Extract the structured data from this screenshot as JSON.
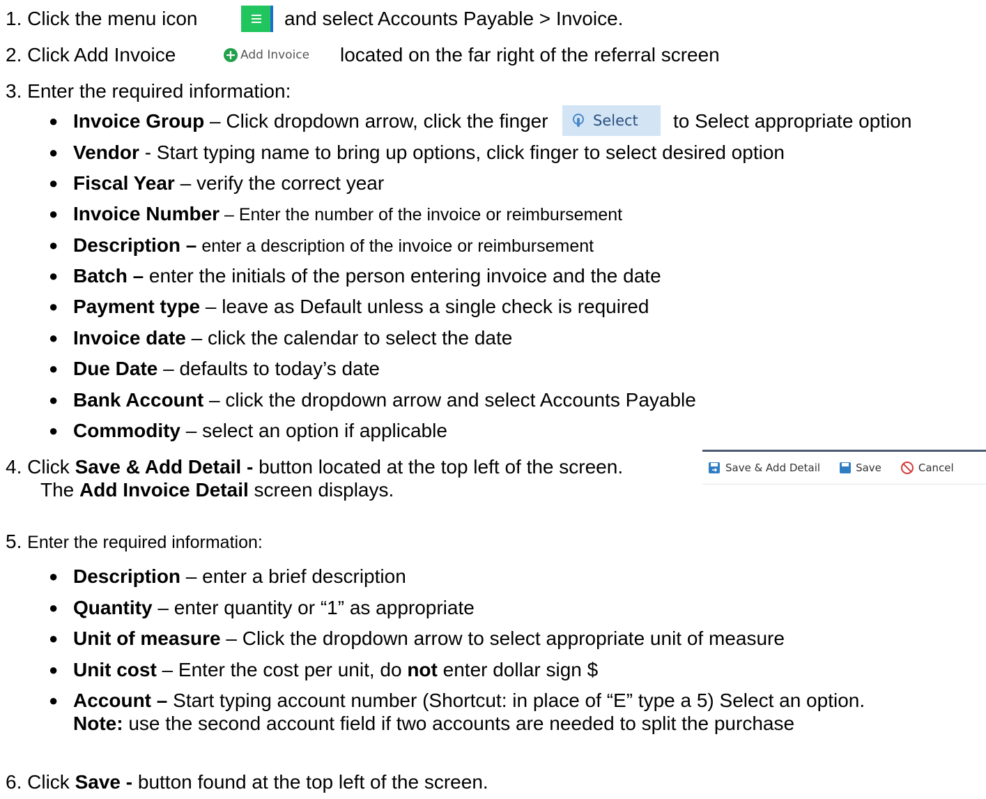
{
  "steps": {
    "s1": {
      "num": "1.",
      "pre": "Click the menu icon",
      "post": "and select Accounts Payable > Invoice."
    },
    "s2": {
      "num": "2.",
      "pre": "Click Add Invoice",
      "btn": "Add Invoice",
      "post": "located on the far right of the referral screen"
    },
    "s3": {
      "num": "3.",
      "text": "Enter the required information:"
    },
    "s4": {
      "num": "4.",
      "pre": "Click ",
      "bold": "Save & Add Detail -",
      "post": " button located at the top left of the screen.",
      "l2pre": "The ",
      "l2bold": "Add Invoice Detail",
      "l2post": " screen displays."
    },
    "s5": {
      "num": "5.",
      "text": "Enter the required information:"
    },
    "s6": {
      "num": "6.",
      "pre": "Click ",
      "bold": "Save -",
      "post": " button found at the top left of the screen."
    }
  },
  "bullets3": [
    {
      "label": "Invoice Group",
      "pre": " – Click dropdown arrow, click the finger",
      "btn": "Select",
      "post": "to Select appropriate option"
    },
    {
      "label": "Vendor",
      "text": " - Start typing name to bring up options, click finger to select desired option"
    },
    {
      "label": "Fiscal Year",
      "text": " – verify the correct year"
    },
    {
      "label": "Invoice Number",
      "text": " – Enter the number of the invoice or reimbursement"
    },
    {
      "label": "Description –",
      "text": " enter a description of the invoice or reimbursement"
    },
    {
      "label": "Batch –",
      "text": " enter the initials of the person entering invoice and the date"
    },
    {
      "label": "Payment type",
      "text": " – leave as Default unless a single check is required"
    },
    {
      "label": "Invoice date",
      "text": " – click the calendar to select the date"
    },
    {
      "label": "Due Date",
      "text": " – defaults to today’s date"
    },
    {
      "label": "Bank Account",
      "text": " – click the dropdown arrow and select Accounts Payable"
    },
    {
      "label": "Commodity",
      "text": " – select an option if applicable"
    }
  ],
  "bullets5": [
    {
      "label": "Description",
      "text": " – enter a brief description"
    },
    {
      "label": "Quantity",
      "text": " – enter quantity or “1” as appropriate"
    },
    {
      "label": "Unit of measure",
      "text": " – Click the dropdown arrow to select appropriate unit of measure"
    },
    {
      "label": "Unit cost",
      "pre": " – Enter the cost per unit, do ",
      "boldmid": "not",
      "post": " enter dollar sign $"
    },
    {
      "label": "Account –",
      "text": " Start typing account number (Shortcut: in place of “E” type a 5) Select an option.",
      "note_label": "Note:",
      "note_text": " use the second account field if two accounts are needed to split the purchase"
    }
  ],
  "toolbar": {
    "save_add": "Save & Add Detail",
    "save": "Save",
    "cancel": "Cancel"
  },
  "icons": {
    "menu": "menu-icon",
    "add": "plus-circle-icon",
    "select": "finger-select-icon",
    "save": "disk-icon",
    "cancel": "prohibited-icon"
  }
}
